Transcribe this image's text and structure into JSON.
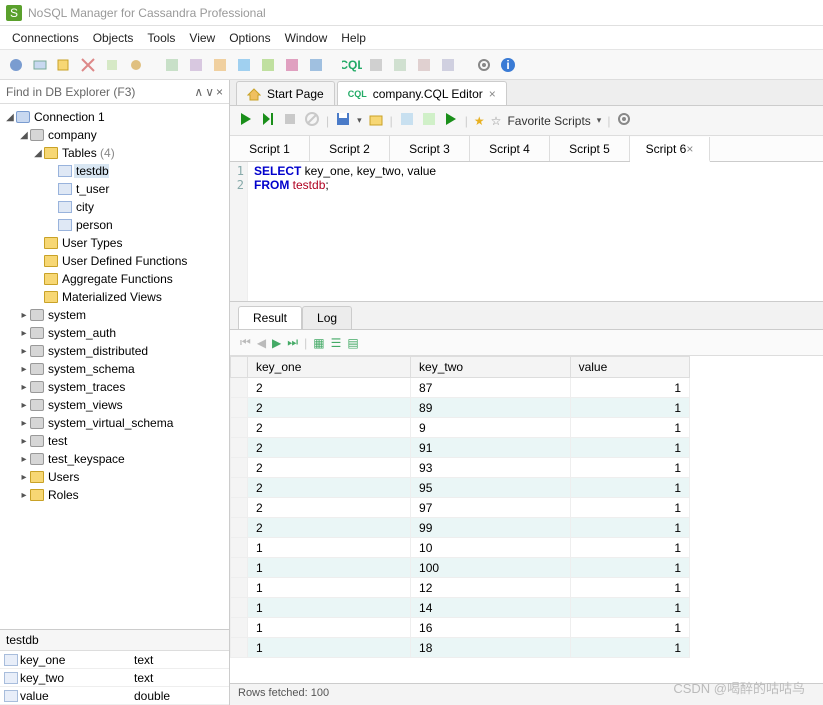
{
  "app_title": "NoSQL Manager for Cassandra Professional",
  "menus": [
    "Connections",
    "Objects",
    "Tools",
    "View",
    "Options",
    "Window",
    "Help"
  ],
  "findbar_placeholder": "Find in DB Explorer (F3)",
  "tree": {
    "connection": "Connection 1",
    "company": "company",
    "tables_label": "Tables",
    "tables_count": "(4)",
    "tables": [
      "testdb",
      "t_user",
      "city",
      "person"
    ],
    "folders": [
      "User Types",
      "User Defined Functions",
      "Aggregate Functions",
      "Materialized Views"
    ],
    "sys_schemas": [
      "system",
      "system_auth",
      "system_distributed",
      "system_schema",
      "system_traces",
      "system_views",
      "system_virtual_schema",
      "test",
      "test_keyspace"
    ],
    "extra": [
      "Users",
      "Roles"
    ]
  },
  "schema_table": "testdb",
  "schema_cols": [
    {
      "name": "key_one",
      "type": "text"
    },
    {
      "name": "key_two",
      "type": "text"
    },
    {
      "name": "value",
      "type": "double"
    }
  ],
  "doc_tabs": {
    "start": "Start Page",
    "editor": "company.CQL Editor",
    "prefix": "CQL"
  },
  "favorite": "Favorite Scripts",
  "script_tabs": [
    "Script 1",
    "Script 2",
    "Script 3",
    "Script 4",
    "Script 5",
    "Script 6"
  ],
  "active_script": "Script 6",
  "code": {
    "l1_kw": "SELECT",
    "l1_rest": " key_one, key_two, value",
    "l2_kw": "FROM",
    "l2_space": " ",
    "l2_id": "testdb",
    "l2_end": ";"
  },
  "result_tabs": {
    "result": "Result",
    "log": "Log"
  },
  "grid_headers": [
    "key_one",
    "key_two",
    "value"
  ],
  "grid_rows": [
    [
      "2",
      "87",
      "1"
    ],
    [
      "2",
      "89",
      "1"
    ],
    [
      "2",
      "9",
      "1"
    ],
    [
      "2",
      "91",
      "1"
    ],
    [
      "2",
      "93",
      "1"
    ],
    [
      "2",
      "95",
      "1"
    ],
    [
      "2",
      "97",
      "1"
    ],
    [
      "2",
      "99",
      "1"
    ],
    [
      "1",
      "10",
      "1"
    ],
    [
      "1",
      "100",
      "1"
    ],
    [
      "1",
      "12",
      "1"
    ],
    [
      "1",
      "14",
      "1"
    ],
    [
      "1",
      "16",
      "1"
    ],
    [
      "1",
      "18",
      "1"
    ]
  ],
  "status": "Rows fetched: 100",
  "watermark": "CSDN @喝醉的咕咕鸟"
}
